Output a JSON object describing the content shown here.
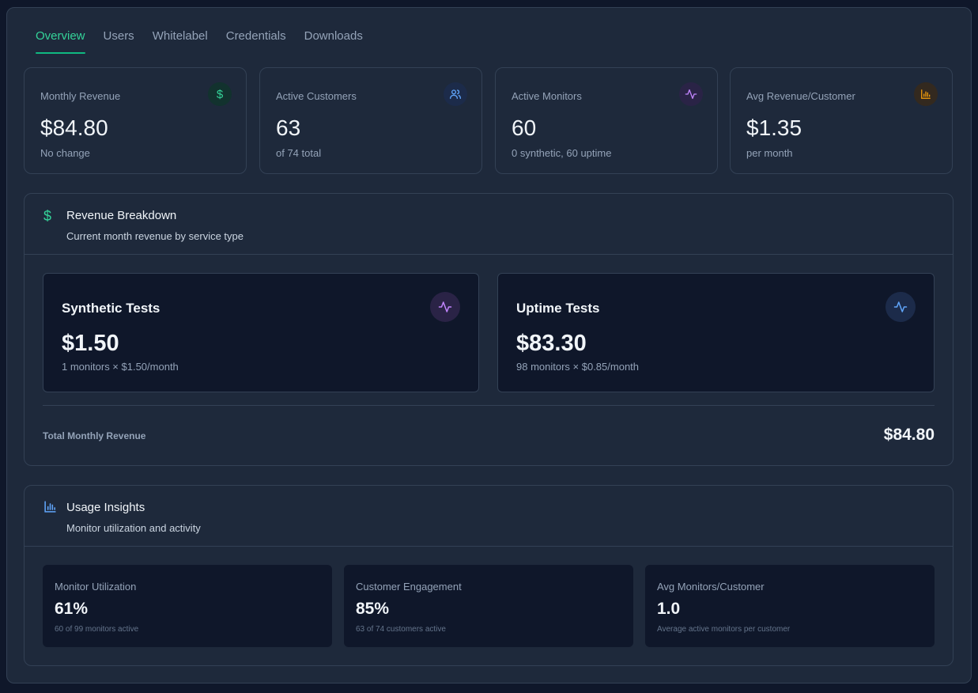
{
  "tabs": [
    {
      "label": "Overview",
      "active": true
    },
    {
      "label": "Users",
      "active": false
    },
    {
      "label": "Whitelabel",
      "active": false
    },
    {
      "label": "Credentials",
      "active": false
    },
    {
      "label": "Downloads",
      "active": false
    }
  ],
  "stats": [
    {
      "label": "Monthly Revenue",
      "value": "$84.80",
      "sub": "No change",
      "icon": "dollar-icon",
      "color": "#34d399"
    },
    {
      "label": "Active Customers",
      "value": "63",
      "sub": "of 74 total",
      "icon": "users-icon",
      "color": "#60a5fa"
    },
    {
      "label": "Active Monitors",
      "value": "60",
      "sub": "0 synthetic, 60 uptime",
      "icon": "activity-icon",
      "color": "#c084fc"
    },
    {
      "label": "Avg Revenue/Customer",
      "value": "$1.35",
      "sub": "per month",
      "icon": "bar-chart-icon",
      "color": "#f59e0b"
    }
  ],
  "revenue_breakdown": {
    "title": "Revenue Breakdown",
    "subtitle": "Current month revenue by service type",
    "cards": [
      {
        "title": "Synthetic Tests",
        "value": "$1.50",
        "sub": "1 monitors × $1.50/month",
        "icon": "activity-icon",
        "color": "#c084fc"
      },
      {
        "title": "Uptime Tests",
        "value": "$83.30",
        "sub": "98 monitors × $0.85/month",
        "icon": "activity-icon",
        "color": "#60a5fa"
      }
    ],
    "total_label": "Total Monthly Revenue",
    "total_value": "$84.80"
  },
  "usage_insights": {
    "title": "Usage Insights",
    "subtitle": "Monitor utilization and activity",
    "cards": [
      {
        "label": "Monitor Utilization",
        "value": "61%",
        "sub": "60 of 99 monitors active"
      },
      {
        "label": "Customer Engagement",
        "value": "85%",
        "sub": "63 of 74 customers active"
      },
      {
        "label": "Avg Monitors/Customer",
        "value": "1.0",
        "sub": "Average active monitors per customer"
      }
    ]
  }
}
